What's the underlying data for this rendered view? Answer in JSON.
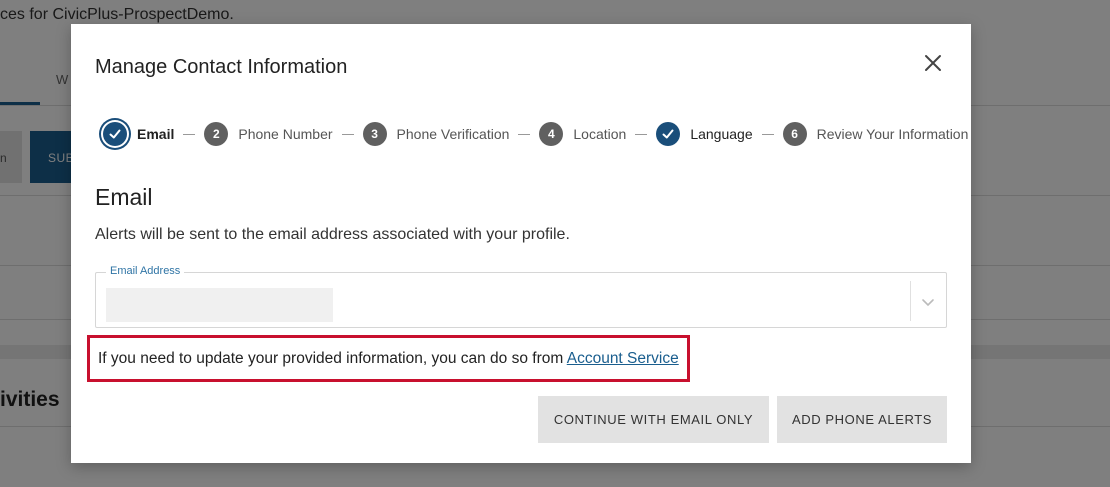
{
  "background": {
    "top_text": "ces for CivicPlus-ProspectDemo.",
    "tab_label": "W",
    "grey_button_label": "n",
    "blue_button_label": "SUB",
    "section_heading": "ivities"
  },
  "modal": {
    "title": "Manage Contact Information",
    "close_icon": "close-icon",
    "steps": [
      {
        "number": "",
        "label": "Email",
        "state": "current"
      },
      {
        "number": "2",
        "label": "Phone Number",
        "state": "pending"
      },
      {
        "number": "3",
        "label": "Phone Verification",
        "state": "pending"
      },
      {
        "number": "4",
        "label": "Location",
        "state": "pending"
      },
      {
        "number": "",
        "label": "Language",
        "state": "done"
      },
      {
        "number": "6",
        "label": "Review Your Information",
        "state": "pending"
      }
    ],
    "section_title": "Email",
    "section_description": "Alerts will be sent to the email address associated with your profile.",
    "email_field": {
      "label": "Email Address",
      "value": ""
    },
    "info": {
      "text": "If you need to update your provided information, you can do so from ",
      "link_text": "Account Service"
    },
    "buttons": {
      "continue_email_only": "CONTINUE WITH EMAIL ONLY",
      "add_phone_alerts": "ADD PHONE ALERTS"
    }
  },
  "colors": {
    "accent": "#1a4e7a",
    "link": "#1a5e8e",
    "highlight_border": "#c8102e",
    "step_pending": "#606060",
    "button_bg": "#e2e2e2"
  }
}
